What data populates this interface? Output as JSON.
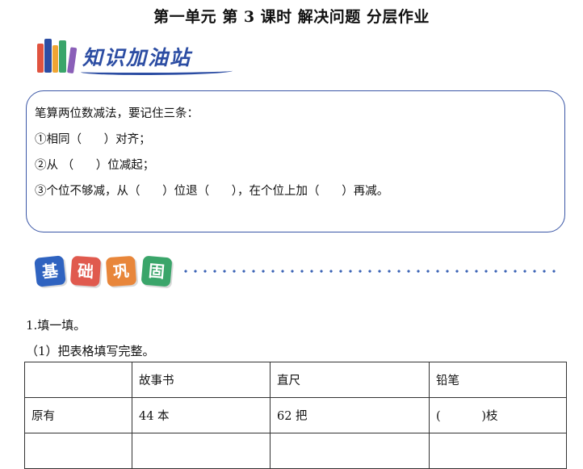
{
  "title": "第一单元  第 3 课时  解决问题  分层作业",
  "banner_knowledge": {
    "label": "知识加油站",
    "books_icon": "books-icon"
  },
  "knowledge_box": {
    "lines": [
      "笔算两位数减法，要记住三条：",
      "①相同（      ）对齐；",
      "②从 （      ）位减起；",
      "③个位不够减，从（      ）位退（      ），在个位上加（      ）再减。"
    ]
  },
  "banner_basic": {
    "tiles": [
      "基",
      "础",
      "巩",
      "固"
    ],
    "tile_colors": [
      "#2f63c0",
      "#e05a4e",
      "#e8863a",
      "#3aa56a"
    ]
  },
  "exercise": {
    "q1": "1.填一填。",
    "q1_1": "（1）把表格填写完整。",
    "table": {
      "header": [
        "",
        "故事书",
        "直尺",
        "铅笔"
      ],
      "rows": [
        [
          "原有",
          "44 本",
          "62 把",
          "(           )枝"
        ],
        [
          "",
          "",
          "",
          ""
        ]
      ]
    }
  }
}
